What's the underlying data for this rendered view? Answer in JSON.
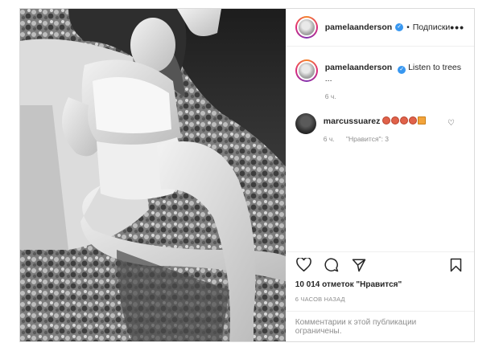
{
  "post": {
    "author": "pamelaanderson",
    "follow_label": "Подписки",
    "dot_separator": "•",
    "more_label": "•••",
    "caption": {
      "username": "pamelaanderson",
      "text": "Listen to trees ...",
      "age": "6 ч."
    },
    "comments": [
      {
        "username": "marcussuarez",
        "emoji_count": 5,
        "age": "6 ч.",
        "likes_label": "\"Нравится\": 3"
      }
    ],
    "likes_text": "10 014 отметок \"Нравится\"",
    "timestamp": "6 ЧАСОВ НАЗАД",
    "comments_restricted": "Комментарии к этой публикации ограничены.",
    "photo": {
      "description": "black and white photograph",
      "palette": [
        "#2b2b2b",
        "#8f8f8f",
        "#e6e6e6"
      ]
    }
  },
  "icons": [
    "verified-badge-icon",
    "more-options-icon",
    "heart-icon",
    "comment-icon",
    "share-icon",
    "bookmark-icon"
  ],
  "colors": {
    "verified": "#3897f0",
    "muted": "#8e8e8e",
    "text": "#262626",
    "border": "#dbdbdb"
  }
}
